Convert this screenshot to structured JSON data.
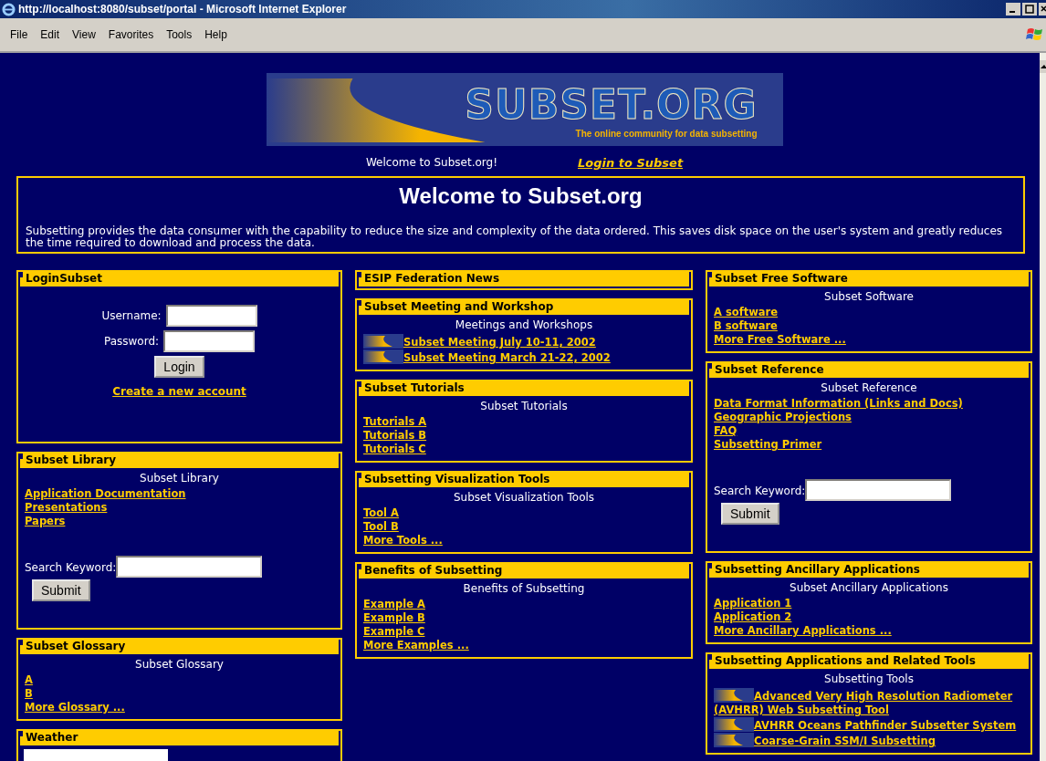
{
  "window": {
    "title": "http://localhost:8080/subset/portal - Microsoft Internet Explorer"
  },
  "menu": [
    "File",
    "Edit",
    "View",
    "Favorites",
    "Tools",
    "Help"
  ],
  "logo": {
    "title": "SUBSET.ORG",
    "tagline": "The online community for data subsetting"
  },
  "welcome_text": "Welcome to Subset.org!",
  "login_link": "Login to Subset",
  "intro": {
    "heading": "Welcome to Subset.org",
    "text": "Subsetting provides the data consumer with the capability to reduce the size and complexity of the data ordered. This saves disk space on the user's system and greatly reduces the time required to download and process the data."
  },
  "columns": [
    [
      {
        "kind": "login",
        "title": "LoginSubset",
        "username_label": "Username:",
        "password_label": "Password:",
        "button": "Login",
        "create_link": "Create a new account"
      },
      {
        "kind": "links",
        "title": "Subset Library",
        "subtitle": "Subset Library",
        "links": [
          {
            "text": "Application Documentation",
            "icon": false
          },
          {
            "text": "Presentations",
            "icon": false
          },
          {
            "text": "Papers",
            "icon": false
          }
        ],
        "search": {
          "label": "Search Keyword:",
          "button": "Submit"
        }
      },
      {
        "kind": "links",
        "title": "Subset Glossary",
        "subtitle": "Subset Glossary",
        "links": [
          {
            "text": "A",
            "icon": false
          },
          {
            "text": "B",
            "icon": false
          },
          {
            "text": "More Glossary ...",
            "icon": false
          }
        ]
      },
      {
        "kind": "weather",
        "title": "Weather"
      }
    ],
    [
      {
        "kind": "links",
        "title": "ESIP Federation News"
      },
      {
        "kind": "links",
        "title": "Subset Meeting and Workshop",
        "subtitle": "Meetings and Workshops",
        "links": [
          {
            "text": "Subset Meeting July 10-11, 2002",
            "icon": true
          },
          {
            "text": "Subset Meeting March 21-22, 2002",
            "icon": true
          }
        ]
      },
      {
        "kind": "links",
        "title": "Subset Tutorials",
        "subtitle": "Subset Tutorials",
        "links": [
          {
            "text": "Tutorials A",
            "icon": false
          },
          {
            "text": "Tutorials B",
            "icon": false
          },
          {
            "text": "Tutorials C",
            "icon": false
          }
        ]
      },
      {
        "kind": "links",
        "title": "Subsetting Visualization Tools",
        "subtitle": "Subset Visualization Tools",
        "links": [
          {
            "text": "Tool A",
            "icon": false
          },
          {
            "text": "Tool B",
            "icon": false
          },
          {
            "text": "More Tools ...",
            "icon": false
          }
        ]
      },
      {
        "kind": "links",
        "title": "Benefits of Subsetting",
        "subtitle": "Benefits of Subsetting",
        "links": [
          {
            "text": "Example A",
            "icon": false
          },
          {
            "text": "Example B",
            "icon": false
          },
          {
            "text": "Example C",
            "icon": false
          },
          {
            "text": "More Examples ...",
            "icon": false
          }
        ]
      }
    ],
    [
      {
        "kind": "links",
        "title": "Subset Free Software",
        "subtitle": "Subset Software",
        "links": [
          {
            "text": "A software",
            "icon": false
          },
          {
            "text": "B software",
            "icon": false
          },
          {
            "text": "More Free Software ...",
            "icon": false
          }
        ]
      },
      {
        "kind": "links",
        "title": "Subset Reference",
        "subtitle": "Subset Reference",
        "links": [
          {
            "text": "Data Format Information (Links and Docs)",
            "icon": false
          },
          {
            "text": "Geographic Projections",
            "icon": false
          },
          {
            "text": "FAQ",
            "icon": false
          },
          {
            "text": "Subsetting Primer",
            "icon": false
          }
        ],
        "search": {
          "label": "Search Keyword:",
          "button": "Submit"
        }
      },
      {
        "kind": "links",
        "title": "Subsetting Ancillary Applications",
        "subtitle": "Subset Ancillary Applications",
        "links": [
          {
            "text": "Application 1",
            "icon": false
          },
          {
            "text": "Application 2",
            "icon": false
          },
          {
            "text": "More Ancillary Applications ...",
            "icon": false
          }
        ]
      },
      {
        "kind": "links",
        "title": "Subsetting Applications and Related Tools",
        "subtitle": "Subsetting Tools",
        "links": [
          {
            "text": "Advanced Very High Resolution Radiometer (AVHRR) Web Subsetting Tool",
            "icon": true
          },
          {
            "text": "AVHRR Oceans Pathfinder Subsetter System",
            "icon": true
          },
          {
            "text": "Coarse-Grain SSM/I Subsetting",
            "icon": true
          }
        ]
      }
    ]
  ]
}
